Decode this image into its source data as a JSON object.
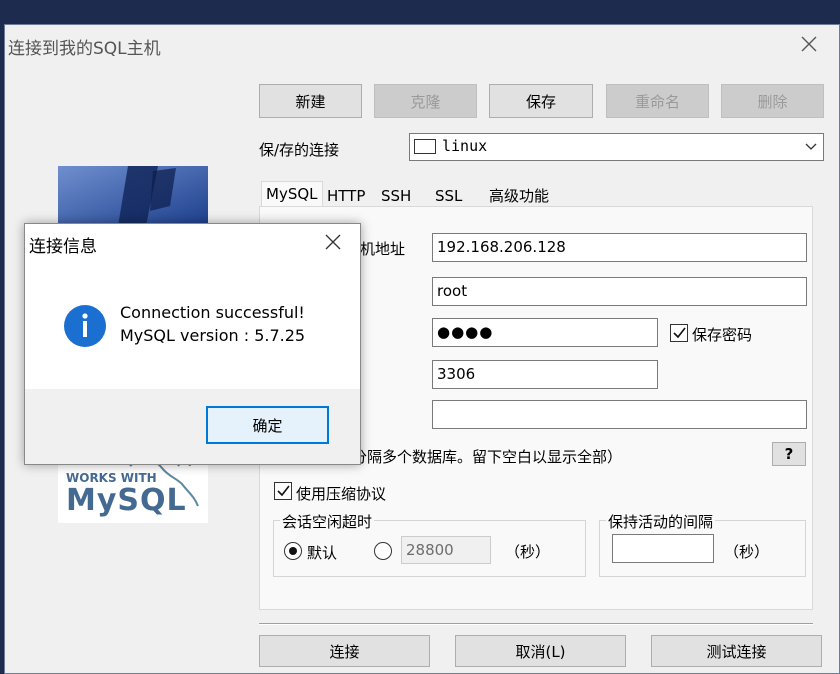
{
  "window": {
    "title": "连接到我的SQL主机"
  },
  "toolbar": {
    "new_label": "新建",
    "clone_label": "克隆",
    "save_label": "保存",
    "rename_label": "重命名",
    "delete_label": "删除"
  },
  "saved_connections": {
    "label": "保/存的连接",
    "value": "linux"
  },
  "logo": {
    "text_top": "WORKS WITH",
    "text_brand": "MySQL"
  },
  "tabs": [
    "MySQL",
    "HTTP",
    "SSH",
    "SSL",
    "高级功能"
  ],
  "form": {
    "host_label_partial": "机地址",
    "host_value": "192.168.206.128",
    "user_value": "root",
    "password_value": "●●●●",
    "save_password_label": "保存密码",
    "save_password_checked": true,
    "port_value": "3306",
    "database_value": "",
    "database_hint_partial": "分隔多个数据库。留下空白以显示全部）",
    "help_label": "?",
    "compression_label": "使用压缩协议",
    "compression_checked": true
  },
  "session_timeout": {
    "title": "会话空闲超时",
    "default_label": "默认",
    "default_selected": true,
    "custom_value": "28800",
    "unit": "（秒）"
  },
  "keepalive": {
    "title": "保持活动的间隔",
    "value": "",
    "unit": "（秒）"
  },
  "footer": {
    "connect_label": "连接",
    "cancel_label": "取消(L)",
    "test_label": "测试连接"
  },
  "dialog": {
    "title": "连接信息",
    "line1": "Connection successful!",
    "line2": "MySQL version : 5.7.25",
    "ok_label": "确定"
  }
}
